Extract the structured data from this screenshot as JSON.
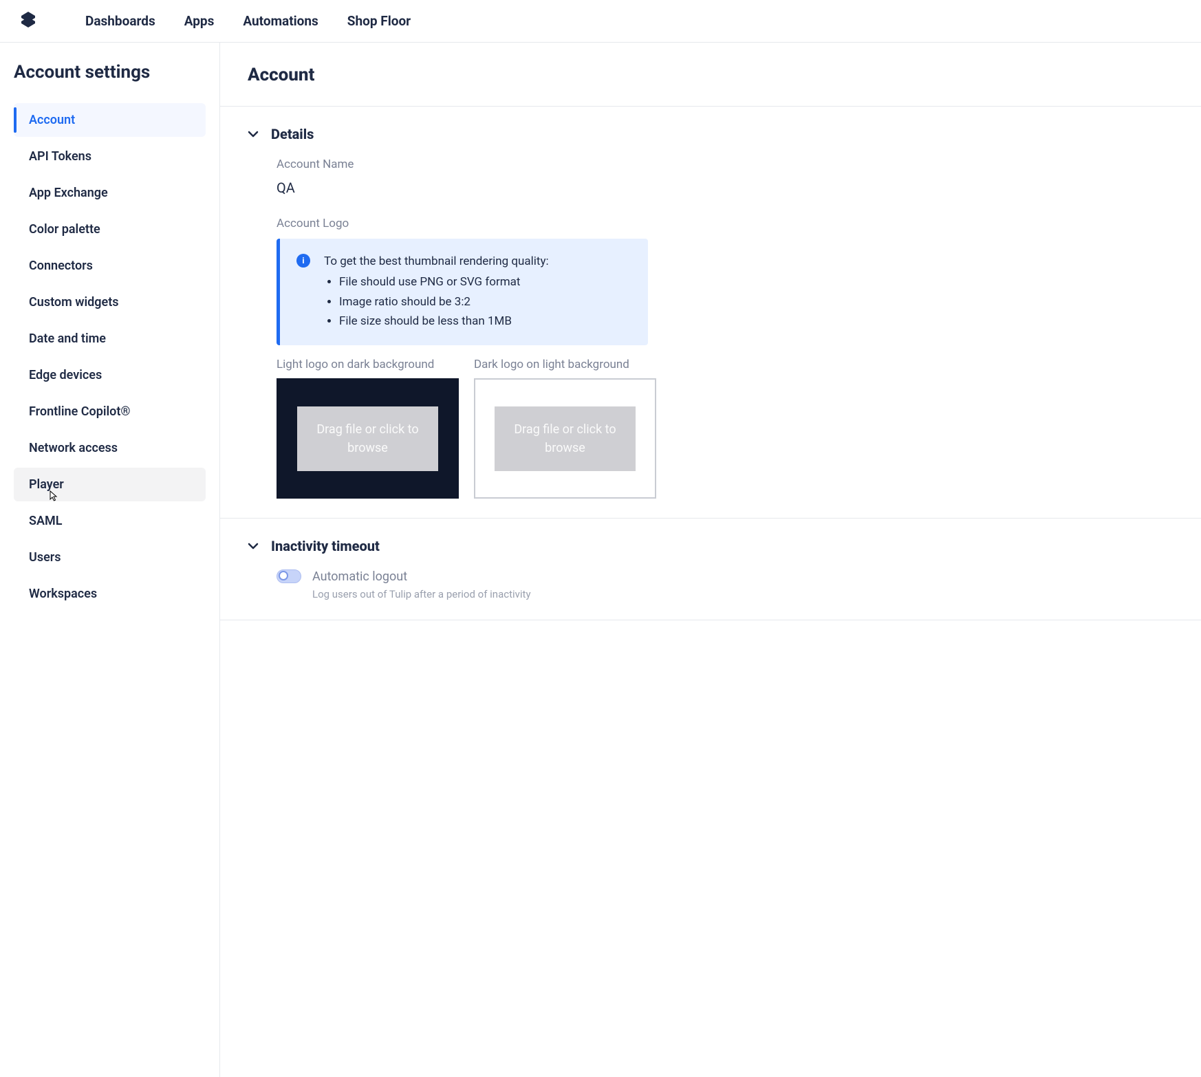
{
  "nav": {
    "items": [
      "Dashboards",
      "Apps",
      "Automations",
      "Shop Floor"
    ]
  },
  "sidebar": {
    "title": "Account settings",
    "items": [
      {
        "label": "Account",
        "selected": true
      },
      {
        "label": "API Tokens"
      },
      {
        "label": "App Exchange"
      },
      {
        "label": "Color palette"
      },
      {
        "label": "Connectors"
      },
      {
        "label": "Custom widgets"
      },
      {
        "label": "Date and time"
      },
      {
        "label": "Edge devices"
      },
      {
        "label": "Frontline Copilot®"
      },
      {
        "label": "Network access"
      },
      {
        "label": "Player",
        "hovered": true
      },
      {
        "label": "SAML"
      },
      {
        "label": "Users"
      },
      {
        "label": "Workspaces"
      }
    ]
  },
  "page": {
    "title": "Account"
  },
  "details": {
    "section_title": "Details",
    "account_name_label": "Account Name",
    "account_name_value": "QA",
    "account_logo_label": "Account Logo",
    "info_intro": "To get the best thumbnail rendering quality:",
    "info_bullets": [
      "File should use PNG or SVG format",
      "Image ratio should be 3:2",
      "File size should be less than 1MB"
    ],
    "light_caption": "Light logo on dark background",
    "dark_caption": "Dark logo on light background",
    "drop_text": "Drag file or click to browse"
  },
  "inactivity": {
    "section_title": "Inactivity timeout",
    "toggle_label": "Automatic logout",
    "toggle_desc": "Log users out of Tulip after a period of inactivity",
    "toggle_on": false
  }
}
